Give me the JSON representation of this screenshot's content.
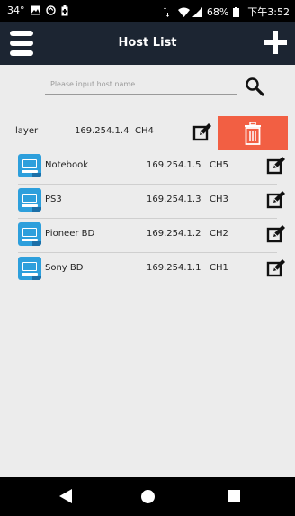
{
  "statusbar": {
    "temp": "34°",
    "battery_pct": "68%",
    "time": "下午3:52"
  },
  "header": {
    "title": "Host List"
  },
  "search": {
    "placeholder": "Please input host name",
    "value": ""
  },
  "hosts": [
    {
      "name": "layer",
      "ip": "169.254.1.4",
      "channel": "CH4",
      "icon": "device-icon",
      "swiped": true
    },
    {
      "name": "Notebook",
      "ip": "169.254.1.5",
      "channel": "CH5",
      "icon": "notebook-device-icon"
    },
    {
      "name": "PS3",
      "ip": "169.254.1.3",
      "channel": "CH3",
      "icon": "ps3-device-icon"
    },
    {
      "name": "Pioneer BD",
      "ip": "169.254.1.2",
      "channel": "CH2",
      "icon": "bd-player-device-icon"
    },
    {
      "name": "Sony BD",
      "ip": "169.254.1.1",
      "channel": "CH1",
      "icon": "bd-player-device-icon"
    }
  ],
  "colors": {
    "header_bg": "#1c2532",
    "delete_bg": "#f25f43",
    "device_icon": "#2d9fdc",
    "page_bg": "#ececec"
  }
}
